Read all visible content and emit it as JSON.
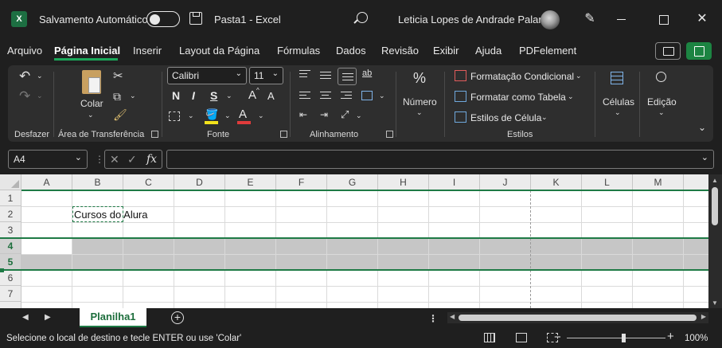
{
  "titlebar": {
    "app_logo": "X",
    "autosave_label": "Salvamento Automático",
    "autosave_on": false,
    "doc_title": "Pasta1  -  Excel",
    "user_name": "Leticia Lopes de Andrade Palaro",
    "close_glyph": "✕"
  },
  "menu": {
    "items": [
      "Arquivo",
      "Página Inicial",
      "Inserir",
      "Layout da Página",
      "Fórmulas",
      "Dados",
      "Revisão",
      "Exibir",
      "Ajuda",
      "PDFelement"
    ],
    "active": "Página Inicial"
  },
  "ribbon": {
    "undo_label": "Desfazer",
    "clipboard": {
      "paste_label": "Colar",
      "group_label": "Área de Transferência"
    },
    "font": {
      "name": "Calibri",
      "size": "11",
      "bold": "N",
      "italic": "I",
      "underline": "S",
      "grow": "A",
      "shrink": "A",
      "group_label": "Fonte",
      "font_color_glyph": "A",
      "highlight_color": "#f2e21c",
      "font_color": "#e03b3b"
    },
    "alignment": {
      "group_label": "Alinhamento",
      "wrap_glyph": "ab"
    },
    "number": {
      "label": "Número",
      "glyph": "%"
    },
    "styles": {
      "conditional": "Formatação Condicional",
      "as_table": "Formatar como Tabela",
      "cell_styles": "Estilos de Célula",
      "group_label": "Estilos"
    },
    "cells_label": "Células",
    "editing_label": "Edição"
  },
  "formula_bar": {
    "name_box": "A4",
    "cancel": "✕",
    "enter": "✓",
    "fx": "fx",
    "value": ""
  },
  "grid": {
    "columns": [
      "A",
      "B",
      "C",
      "D",
      "E",
      "F",
      "G",
      "H",
      "I",
      "J",
      "K",
      "L",
      "M"
    ],
    "rows": [
      "1",
      "2",
      "3",
      "4",
      "5",
      "6",
      "7"
    ],
    "selected_rows": [
      "4",
      "5"
    ],
    "active_cell": "A4",
    "copy_range": "B2",
    "cells": {
      "B2": "Cursos do Alura"
    }
  },
  "sheets": {
    "tabs": [
      "Planilha1"
    ],
    "active": "Planilha1",
    "add_glyph": "+"
  },
  "status": {
    "message": "Selecione o local de destino e tecle ENTER ou use 'Colar'",
    "zoom": "100%",
    "zoom_minus": "−",
    "zoom_plus": "+"
  },
  "colors": {
    "accent": "#1e7a45",
    "share_button": "#1c8442"
  }
}
